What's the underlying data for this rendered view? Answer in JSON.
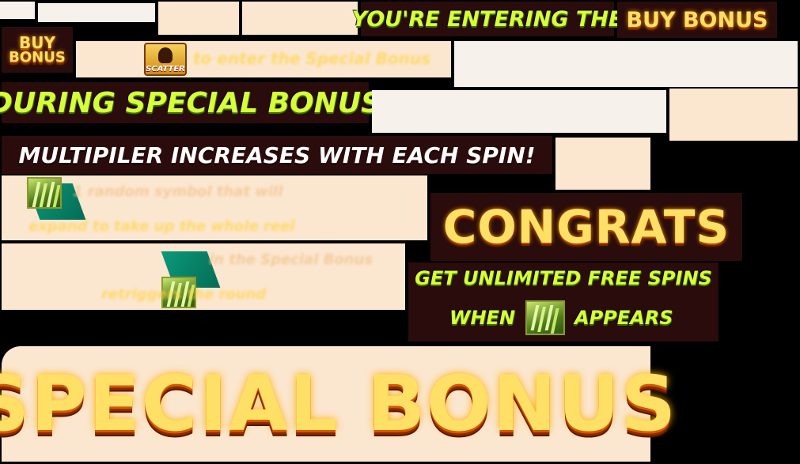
{
  "headline_entering": "YOU'RE ENTERING THE",
  "buy_bonus_text": "BUY BONUS",
  "buy_bonus_badge": {
    "line1": "BUY",
    "line2": "BONUS"
  },
  "scatter_label": "SCATTER",
  "scatter_hint": "to enter the Special Bonus",
  "during_special_bonus": "DURING SPECIAL BONUS",
  "multiplier_text": "MULTIPILER INCREASES WITH EACH SPIN!",
  "random_symbol_hint": {
    "line1": "1 random symbol that will",
    "line2": "expand to take up the whole reel"
  },
  "special_bonus_hint": {
    "line1": "in the Special Bonus",
    "line2": "retriggers the round"
  },
  "congrats": "CONGRATS",
  "unlimited": {
    "line1": "GET UNLIMITED FREE SPINS",
    "line2_a": "WHEN",
    "line2_b": "APPEARS"
  },
  "special_bonus_title": "SPECIAL BONUS",
  "icons": [
    "scatter-bird-icon",
    "wild-grass-icon"
  ],
  "colors": {
    "green": "#d6ff3a",
    "gold": "#ffe066",
    "plate": "#2a0c0c",
    "cream": "#fbe6cf"
  }
}
